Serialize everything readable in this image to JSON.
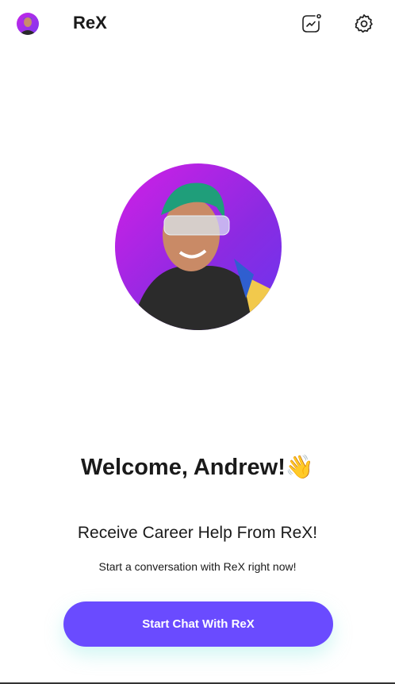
{
  "header": {
    "title": "ReX",
    "icons": [
      "user-avatar",
      "analytics-icon",
      "gear-icon"
    ]
  },
  "main": {
    "welcome": "Welcome, Andrew!",
    "welcome_emoji": "👋",
    "subtitle": "Receive Career Help From ReX!",
    "description": "Start a conversation with ReX right now!",
    "cta_label": "Start Chat With ReX"
  },
  "colors": {
    "accent": "#6a4bff",
    "avatar_gradient_start": "#d21fe6",
    "avatar_gradient_end": "#6a35f0"
  }
}
